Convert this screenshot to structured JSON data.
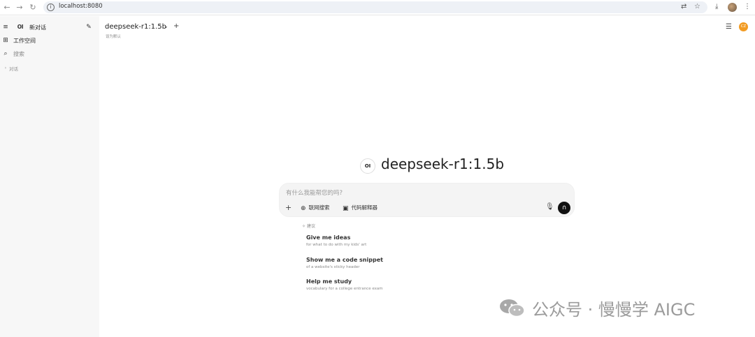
{
  "browser": {
    "url": "localhost:8080",
    "back_icon": "arrow-left-icon",
    "forward_icon": "arrow-right-icon",
    "reload_icon": "reload-icon"
  },
  "sidebar": {
    "new_chat_label": "新对话",
    "logo_text": "OI",
    "workspace_label": "工作空间",
    "search_label": "搜索",
    "chats_label": "对话"
  },
  "header": {
    "model_name": "deepseek-r1:1.5b",
    "set_default": "设为默认",
    "avatar_text": "CZ"
  },
  "hero": {
    "logo_text": "OI",
    "title": "deepseek-r1:1.5b"
  },
  "chat": {
    "placeholder": "有什么我能帮您的吗?",
    "web_search_label": "联网搜索",
    "code_interpreter_label": "代码解释器"
  },
  "suggestions": {
    "heading": "建议",
    "items": [
      {
        "title": "Give me ideas",
        "subtitle": "for what to do with my kids' art"
      },
      {
        "title": "Show me a code snippet",
        "subtitle": "of a website's sticky header"
      },
      {
        "title": "Help me study",
        "subtitle": "vocabulary for a college entrance exam"
      }
    ]
  },
  "watermark": {
    "text": "公众号 · 慢慢学 AIGC"
  },
  "colors": {
    "avatar": "#f29b22",
    "sidebar_bg": "#f7f7f7",
    "chat_box_bg": "#f4f4f4"
  }
}
